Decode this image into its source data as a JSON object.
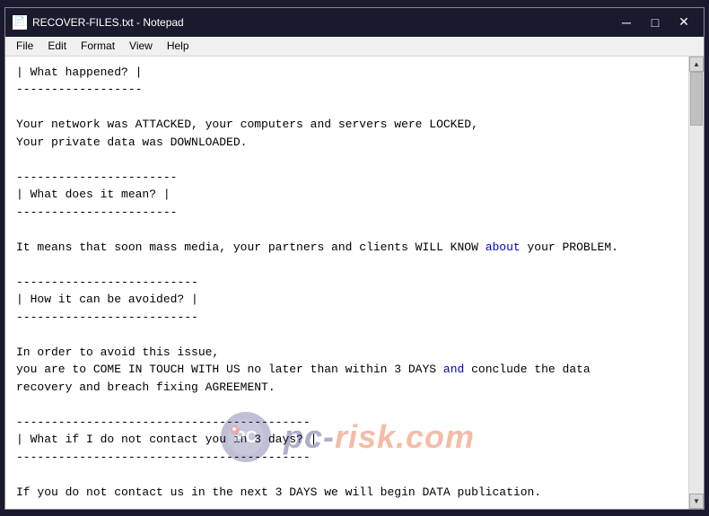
{
  "window": {
    "title": "RECOVER-FILES.txt - Notepad",
    "icon": "📄"
  },
  "menu": {
    "items": [
      "File",
      "Edit",
      "Format",
      "View",
      "Help"
    ]
  },
  "content": {
    "lines": "| What happened? |\n------------------\n\nYour network was ATTACKED, your computers and servers were LOCKED,\nYour private data was DOWNLOADED.\n\n-----------------------\n| What does it mean? |\n-----------------------\n\nIt means that soon mass media, your partners and clients WILL KNOW about your PROBLEM.\n\n--------------------------\n| How it can be avoided? |\n--------------------------\n\nIn order to avoid this issue,\nyou are to COME IN TOUCH WITH US no later than within 3 DAYS and conclude the data\nrecovery and breach fixing AGREEMENT.\n\n------------------------------------------\n| What if I do not contact you in 3 days? |\n------------------------------------------\n\nIf you do not contact us in the next 3 DAYS we will begin DATA publication.\n\n--\nI can handle it by mysel..."
  },
  "titlebar": {
    "minimize": "─",
    "maximize": "□",
    "close": "✕"
  },
  "watermark": {
    "site": "pc-",
    "site2": "risk.com"
  }
}
